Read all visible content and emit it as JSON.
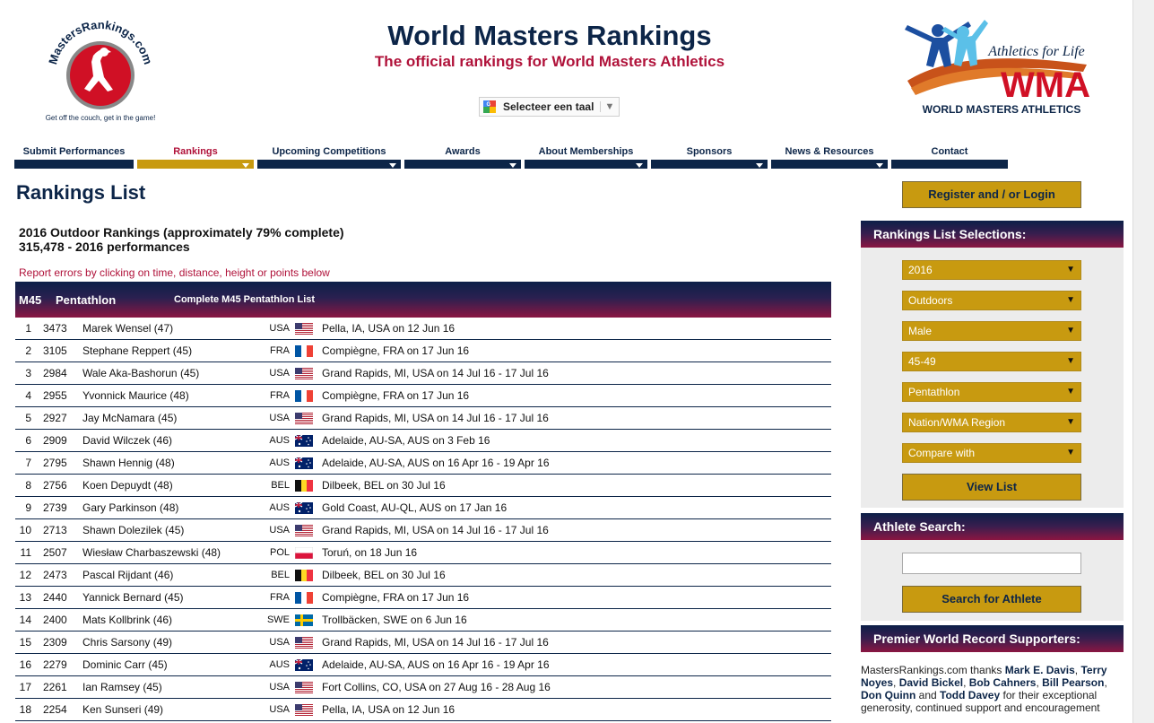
{
  "header": {
    "logo_left_text": "MastersRankings.com",
    "logo_left_tagline": "Get off the couch, get in the game!",
    "title": "World Masters Rankings",
    "subtitle": "The official rankings for World Masters Athletics",
    "language_select": "Selecteer een taal",
    "logo_right_tagline": "Athletics for Life",
    "logo_right_wordmark": "WMA",
    "logo_right_name": "WORLD MASTERS ATHLETICS"
  },
  "nav": {
    "items": [
      {
        "label": "Submit Performances",
        "active": false,
        "dropdown": false
      },
      {
        "label": "Rankings",
        "active": true,
        "dropdown": true
      },
      {
        "label": "Upcoming Competitions",
        "active": false,
        "dropdown": true
      },
      {
        "label": "Awards",
        "active": false,
        "dropdown": true
      },
      {
        "label": "About Memberships",
        "active": false,
        "dropdown": true
      },
      {
        "label": "Sponsors",
        "active": false,
        "dropdown": true
      },
      {
        "label": "News & Resources",
        "active": false,
        "dropdown": true
      },
      {
        "label": "Contact",
        "active": false,
        "dropdown": false
      }
    ]
  },
  "main": {
    "page_title": "Rankings List",
    "summary_line1": "2016 Outdoor Rankings (approximately 79% complete)",
    "summary_line2": "315,478 - 2016 performances",
    "report_note": "Report errors by clicking on time, distance, height or points below",
    "table_header": {
      "age_group": "M45",
      "event": "Pentathlon",
      "complete_link": "Complete M45 Pentathlon List"
    },
    "rows": [
      {
        "rank": "1",
        "mark": "3473",
        "name": "Marek Wensel (47)",
        "nat": "USA",
        "flag": "usa-flag-icon",
        "venue": "Pella, IA, USA on 12 Jun 16"
      },
      {
        "rank": "2",
        "mark": "3105",
        "name": "Stephane Reppert (45)",
        "nat": "FRA",
        "flag": "fra-flag-icon",
        "venue": "Compiègne, FRA on 17 Jun 16"
      },
      {
        "rank": "3",
        "mark": "2984",
        "name": "Wale Aka-Bashorun (45)",
        "nat": "USA",
        "flag": "usa-flag-icon",
        "venue": "Grand Rapids, MI, USA on 14 Jul 16 - 17 Jul 16"
      },
      {
        "rank": "4",
        "mark": "2955",
        "name": "Yvonnick Maurice (48)",
        "nat": "FRA",
        "flag": "fra-flag-icon",
        "venue": "Compiègne, FRA on 17 Jun 16"
      },
      {
        "rank": "5",
        "mark": "2927",
        "name": "Jay McNamara (45)",
        "nat": "USA",
        "flag": "usa-flag-icon",
        "venue": "Grand Rapids, MI, USA on 14 Jul 16 - 17 Jul 16"
      },
      {
        "rank": "6",
        "mark": "2909",
        "name": "David Wilczek (46)",
        "nat": "AUS",
        "flag": "aus-flag-icon",
        "venue": "Adelaide, AU-SA, AUS on 3 Feb 16"
      },
      {
        "rank": "7",
        "mark": "2795",
        "name": "Shawn Hennig (48)",
        "nat": "AUS",
        "flag": "aus-flag-icon",
        "venue": "Adelaide, AU-SA, AUS on 16 Apr 16 - 19 Apr 16"
      },
      {
        "rank": "8",
        "mark": "2756",
        "name": "Koen Depuydt (48)",
        "nat": "BEL",
        "flag": "bel-flag-icon",
        "venue": "Dilbeek, BEL on 30 Jul 16"
      },
      {
        "rank": "9",
        "mark": "2739",
        "name": "Gary Parkinson (48)",
        "nat": "AUS",
        "flag": "aus-flag-icon",
        "venue": "Gold Coast, AU-QL, AUS on 17 Jan 16"
      },
      {
        "rank": "10",
        "mark": "2713",
        "name": "Shawn Dolezilek (45)",
        "nat": "USA",
        "flag": "usa-flag-icon",
        "venue": "Grand Rapids, MI, USA on 14 Jul 16 - 17 Jul 16"
      },
      {
        "rank": "11",
        "mark": "2507",
        "name": "Wiesław Charbaszewski (48)",
        "nat": "POL",
        "flag": "pol-flag-icon",
        "venue": "Toruń, on 18 Jun 16"
      },
      {
        "rank": "12",
        "mark": "2473",
        "name": "Pascal Rijdant (46)",
        "nat": "BEL",
        "flag": "bel-flag-icon",
        "venue": "Dilbeek, BEL on 30 Jul 16"
      },
      {
        "rank": "13",
        "mark": "2440",
        "name": "Yannick Bernard (45)",
        "nat": "FRA",
        "flag": "fra-flag-icon",
        "venue": "Compiègne, FRA on 17 Jun 16"
      },
      {
        "rank": "14",
        "mark": "2400",
        "name": "Mats Kollbrink (46)",
        "nat": "SWE",
        "flag": "swe-flag-icon",
        "venue": "Trollbäcken, SWE on 6 Jun 16"
      },
      {
        "rank": "15",
        "mark": "2309",
        "name": "Chris Sarsony (49)",
        "nat": "USA",
        "flag": "usa-flag-icon",
        "venue": "Grand Rapids, MI, USA on 14 Jul 16 - 17 Jul 16"
      },
      {
        "rank": "16",
        "mark": "2279",
        "name": "Dominic Carr (45)",
        "nat": "AUS",
        "flag": "aus-flag-icon",
        "venue": "Adelaide, AU-SA, AUS on 16 Apr 16 - 19 Apr 16"
      },
      {
        "rank": "17",
        "mark": "2261",
        "name": "Ian Ramsey (45)",
        "nat": "USA",
        "flag": "usa-flag-icon",
        "venue": "Fort Collins, CO, USA on 27 Aug 16 - 28 Aug 16"
      },
      {
        "rank": "18",
        "mark": "2254",
        "name": "Ken Sunseri (49)",
        "nat": "USA",
        "flag": "usa-flag-icon",
        "venue": "Pella, IA, USA on 12 Jun 16"
      }
    ]
  },
  "sidebar": {
    "register_button": "Register and / or Login",
    "selections_heading": "Rankings List Selections:",
    "selects": [
      "2016",
      "Outdoors",
      "Male",
      "45-49",
      "Pentathlon",
      "Nation/WMA Region",
      "Compare with"
    ],
    "view_list_button": "View List",
    "athlete_search_heading": "Athlete Search:",
    "search_input_value": "",
    "search_button": "Search for Athlete",
    "supporters_heading": "Premier World Record Supporters:",
    "supporters_text_1": "MastersRankings.com thanks ",
    "supporters_names": [
      "Mark E. Davis",
      "Terry Noyes",
      "David Bickel",
      "Bob Cahners",
      "Bill Pearson",
      "Don Quinn",
      "Todd Davey"
    ],
    "supporters_text_2": " for their exceptional generosity, continued support and encouragement"
  },
  "colors": {
    "navy": "#0c2548",
    "crimson": "#b0123a",
    "gold": "#c89a10"
  }
}
